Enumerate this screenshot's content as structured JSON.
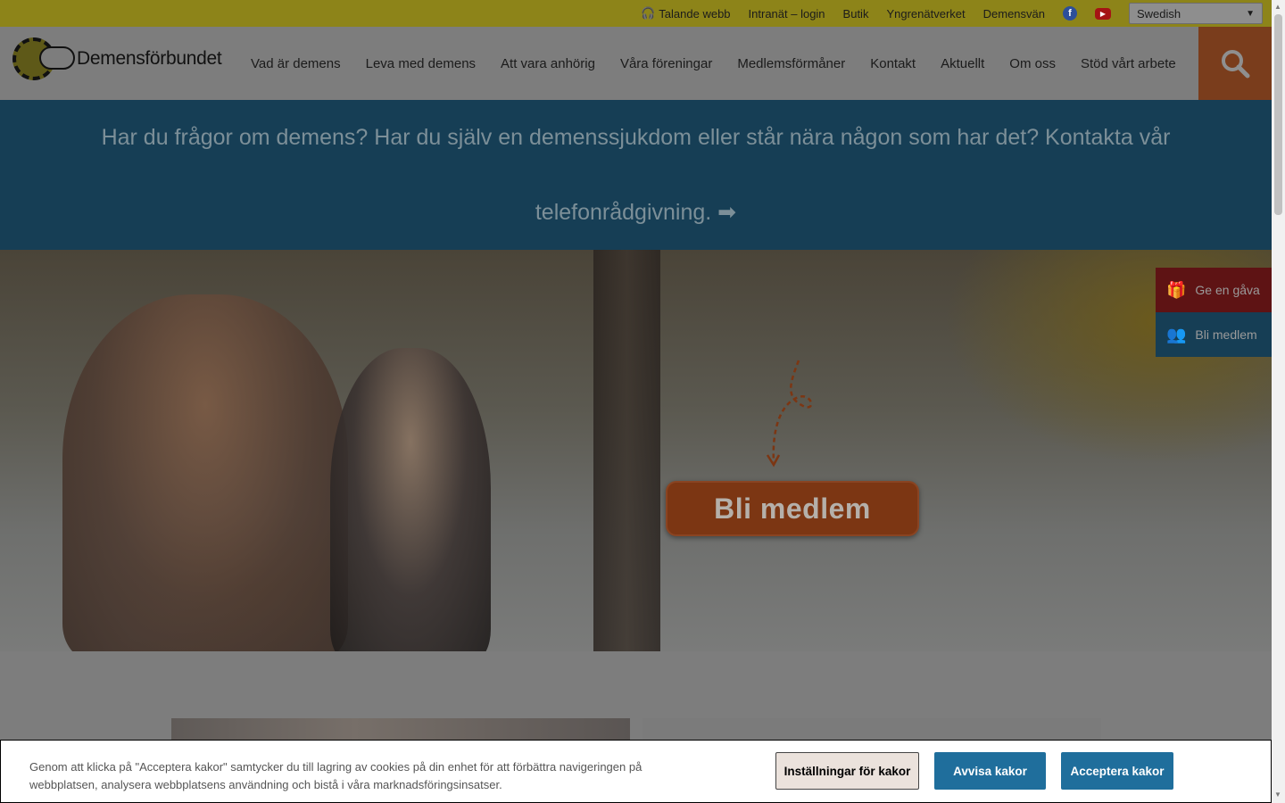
{
  "topbar": {
    "links": [
      "Talande webb",
      "Intranät – login",
      "Butik",
      "Yngrenätverket",
      "Demensvän"
    ],
    "social": [
      "facebook-icon",
      "youtube-icon"
    ],
    "language": "Swedish"
  },
  "header": {
    "logo_text": "Demensförbundet",
    "nav": [
      "Vad är demens",
      "Leva med demens",
      "Att vara anhörig",
      "Våra föreningar",
      "Medlemsförmåner",
      "Kontakt",
      "Aktuellt",
      "Om oss",
      "Stöd vårt arbete"
    ]
  },
  "banner": {
    "text": "Har du frågor om demens? Har du själv en demenssjukdom eller står nära någon som har det? Kontakta vår telefonrådgivning. ➡"
  },
  "hero": {
    "cta": "Bli medlem"
  },
  "sidetabs": {
    "gift": "Ge en gåva",
    "member": "Bli medlem"
  },
  "cookie": {
    "text": "Genom att klicka på \"Acceptera kakor\" samtycker du till lagring av cookies på din enhet för att förbättra navigeringen på webbplatsen, analysera webbplatsens användning och bistå i våra marknadsföringsinsatser.",
    "settings": "Inställningar för kakor",
    "reject": "Avvisa kakor",
    "accept": "Acceptera kakor"
  },
  "colors": {
    "topbar": "#8d8419",
    "banner": "#163e55",
    "search": "#7a3d1c",
    "gift": "#5e1314",
    "cookie_button": "#1f6e9c"
  }
}
